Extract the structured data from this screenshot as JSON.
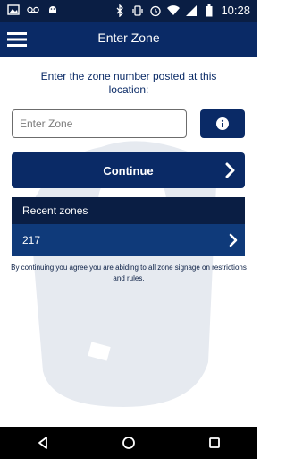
{
  "status_bar": {
    "time": "10:28"
  },
  "app_bar": {
    "title": "Enter Zone"
  },
  "main": {
    "prompt": "Enter the zone number posted at this location:",
    "zone_input": {
      "placeholder": "Enter Zone",
      "value": ""
    },
    "continue_label": "Continue",
    "recent": {
      "header": "Recent zones",
      "items": [
        {
          "label": "217"
        }
      ]
    },
    "disclaimer": "By continuing you agree you are abiding to all zone signage on restrictions and rules."
  },
  "colors": {
    "primary": "#0a2a66",
    "status_bar": "#0a1e44",
    "recent_item": "#0f3a7a"
  },
  "icons": {
    "menu": "hamburger-icon",
    "info": "info-icon",
    "continue": "chevron-right-icon",
    "recent_item": "chevron-right-icon",
    "nav_back": "back-triangle-icon",
    "nav_home": "home-circle-icon",
    "nav_recent": "overview-square-icon"
  }
}
